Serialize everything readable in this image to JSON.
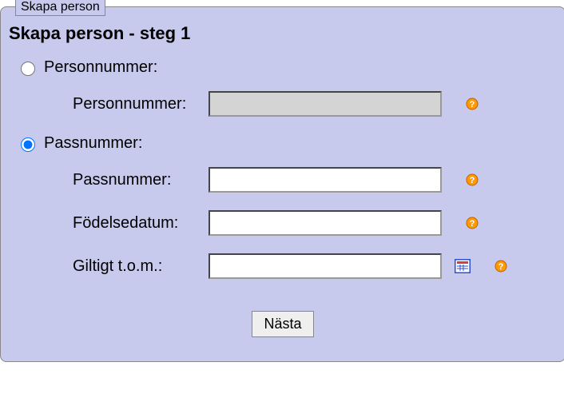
{
  "panel": {
    "legend": "Skapa person"
  },
  "title": "Skapa person - steg 1",
  "options": {
    "personnummer_label": "Personnummer:",
    "passnummer_label": "Passnummer:",
    "selected": "passnummer"
  },
  "fields": {
    "personnummer": {
      "label": "Personnummer:",
      "value": ""
    },
    "passnummer": {
      "label": "Passnummer:",
      "value": ""
    },
    "fodelsedatum": {
      "label": "Födelsedatum:",
      "value": ""
    },
    "giltigt_tom": {
      "label": "Giltigt t.o.m.:",
      "value": ""
    }
  },
  "buttons": {
    "next": "Nästa"
  },
  "icons": {
    "help": "help-icon",
    "calendar": "calendar-icon"
  }
}
